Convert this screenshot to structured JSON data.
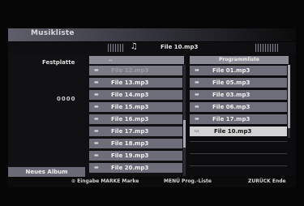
{
  "screen": {
    "title": "Musikliste",
    "now_playing": "File 10.mp3",
    "note_icon": "♫",
    "source_label": "Festplatte",
    "counter": "0000",
    "new_album_label": "Neues Album"
  },
  "file_list": {
    "header": "..",
    "items": [
      {
        "name": "File 12.mp3",
        "dim": true
      },
      {
        "name": "File 13.mp3",
        "dim": false
      },
      {
        "name": "File 14.mp3",
        "dim": false
      },
      {
        "name": "File 15.mp3",
        "dim": false
      },
      {
        "name": "File 16.mp3",
        "dim": false
      },
      {
        "name": "File 17.mp3",
        "dim": false
      },
      {
        "name": "File 18.mp3",
        "dim": false
      },
      {
        "name": "File 19.mp3",
        "dim": false
      },
      {
        "name": "File 20.mp3",
        "dim": false
      }
    ]
  },
  "program_list": {
    "header": "Programmliste",
    "items": [
      {
        "name": "File 01.mp3",
        "selected": false
      },
      {
        "name": "File 05.mp3",
        "selected": false
      },
      {
        "name": "File 03.mp3",
        "selected": false
      },
      {
        "name": "File 06.mp3",
        "selected": false
      },
      {
        "name": "File 17.mp3",
        "selected": false
      },
      {
        "name": "File 10.mp3",
        "selected": true
      }
    ]
  },
  "help_bar": {
    "item1": "⊙ Eingabe  MARKE Marke",
    "item2": "MENÜ Prog.-Liste",
    "item3": "ZURÜCK Ende"
  },
  "colors": {
    "row": "#6e6e7a",
    "selected_row": "#d2d2d4",
    "header": "#8a8a95",
    "background": "#060606"
  }
}
